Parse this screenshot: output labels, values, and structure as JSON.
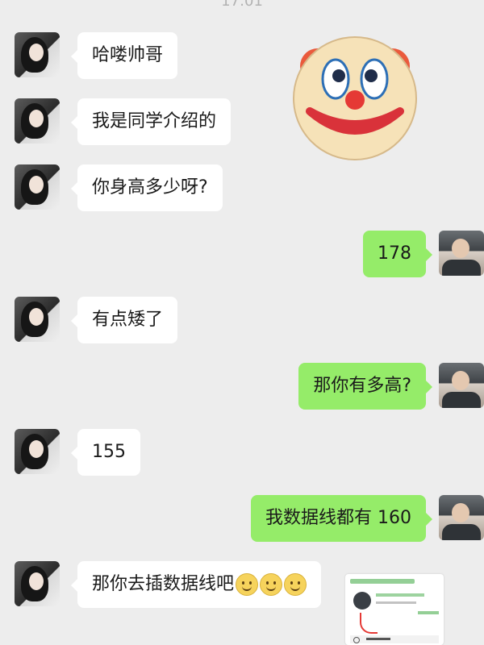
{
  "status": {
    "time": "17:01"
  },
  "messages": [
    {
      "from": "her",
      "text": "哈喽帅哥"
    },
    {
      "from": "her",
      "text": "我是同学介绍的"
    },
    {
      "from": "her",
      "text": "你身高多少呀?"
    },
    {
      "from": "me",
      "text": "178"
    },
    {
      "from": "her",
      "text": "有点矮了"
    },
    {
      "from": "me",
      "text": "那你有多高?"
    },
    {
      "from": "her",
      "text": "155"
    },
    {
      "from": "me",
      "text": "我数据线都有 160"
    },
    {
      "from": "her",
      "text": "那你去插数据线吧",
      "emojis": [
        "smile-emoji",
        "smile-emoji",
        "smile-emoji"
      ]
    }
  ],
  "stickers": {
    "clown": "clown-face-sticker"
  },
  "watermark": "",
  "colors": {
    "background": "#ededed",
    "incoming": "#ffffff",
    "outgoing": "#95ec69"
  }
}
